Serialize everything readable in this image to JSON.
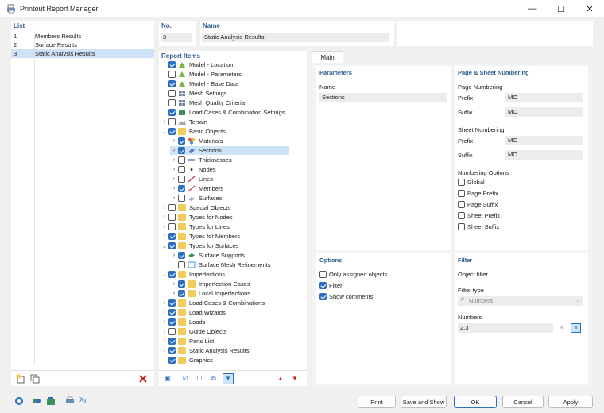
{
  "window": {
    "title": "Printout Report Manager",
    "minimize": "—",
    "maximize": "☐",
    "close": "✕"
  },
  "list": {
    "header": "List",
    "items": [
      {
        "num": "1",
        "label": "Members Results"
      },
      {
        "num": "2",
        "label": "Surface Results"
      },
      {
        "num": "3",
        "label": "Static Analysis Results"
      }
    ]
  },
  "no": {
    "label": "No.",
    "value": "3"
  },
  "name": {
    "label": "Name",
    "value": "Static Analysis Results"
  },
  "report_items": {
    "header": "Report Items",
    "rows": [
      {
        "label": "Model - Location"
      },
      {
        "label": "Model - Parameters"
      },
      {
        "label": "Model - Base Data"
      },
      {
        "label": "Mesh Settings"
      },
      {
        "label": "Mesh Quality Criteria"
      },
      {
        "label": "Load Cases & Combination Settings"
      },
      {
        "label": "Terrain"
      },
      {
        "label": "Basic Objects"
      },
      {
        "label": "Materials"
      },
      {
        "label": "Sections"
      },
      {
        "label": "Thicknesses"
      },
      {
        "label": "Nodes"
      },
      {
        "label": "Lines"
      },
      {
        "label": "Members"
      },
      {
        "label": "Surfaces"
      },
      {
        "label": "Special Objects"
      },
      {
        "label": "Types for Nodes"
      },
      {
        "label": "Types for Lines"
      },
      {
        "label": "Types for Members"
      },
      {
        "label": "Types for Surfaces"
      },
      {
        "label": "Surface Supports"
      },
      {
        "label": "Surface Mesh Refinements"
      },
      {
        "label": "Imperfections"
      },
      {
        "label": "Imperfection Cases"
      },
      {
        "label": "Local Imperfections"
      },
      {
        "label": "Load Cases & Combinations"
      },
      {
        "label": "Load Wizards"
      },
      {
        "label": "Loads"
      },
      {
        "label": "Guide Objects"
      },
      {
        "label": "Parts List"
      },
      {
        "label": "Static Analysis Results"
      },
      {
        "label": "Graphics"
      }
    ]
  },
  "tabs": [
    {
      "label": "Main"
    }
  ],
  "parameters": {
    "header": "Parameters",
    "name_label": "Name",
    "name_value": "Sections"
  },
  "numbering": {
    "header": "Page & Sheet Numbering",
    "page_numbering": "Page Numbering",
    "page_prefix_label": "Prefix",
    "page_prefix_value": "MO",
    "page_suffix_label": "Suffix",
    "page_suffix_value": "MO",
    "sheet_numbering": "Sheet Numbering",
    "sheet_prefix_label": "Prefix",
    "sheet_prefix_value": "MO",
    "sheet_suffix_label": "Suffix",
    "sheet_suffix_value": "MO",
    "options_header": "Numbering Options",
    "options": [
      "Global",
      "Page Prefix",
      "Page Suffix",
      "Sheet Prefix",
      "Sheet Suffix"
    ]
  },
  "options": {
    "header": "Options",
    "items": [
      "Only assigned objects",
      "Filter",
      "Show comments"
    ]
  },
  "filter": {
    "header": "Filter",
    "object_filter": "Object filter",
    "filter_type_label": "Filter type",
    "filter_type_value": "Numbers",
    "numbers_label": "Numbers",
    "numbers_value": "2,3"
  },
  "buttons": {
    "print": "Print",
    "save_show": "Save and Show",
    "ok": "OK",
    "cancel": "Cancel",
    "apply": "Apply"
  },
  "colors": {
    "accent": "#2c6fc1",
    "header_text": "#2b5b8f",
    "selection": "#cfe3f7",
    "folder": "#f3cd5a",
    "delete": "#d32020"
  }
}
